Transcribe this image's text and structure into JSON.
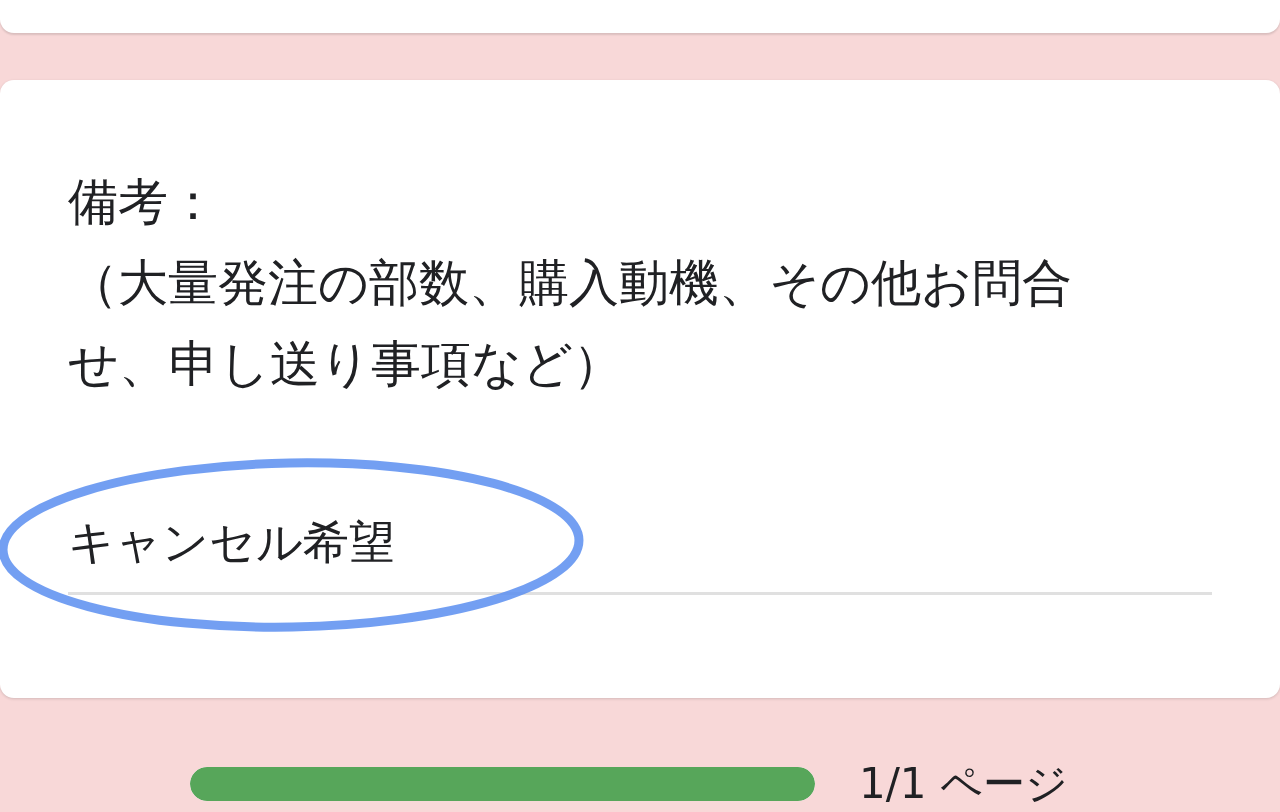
{
  "question": {
    "title": "備考：",
    "description": "（大量発注の部数、購入動機、その他お問合せ、申し送り事項など）",
    "answer": "キャンセル希望"
  },
  "progress": {
    "level": 1,
    "label": "1/1 ページ"
  }
}
